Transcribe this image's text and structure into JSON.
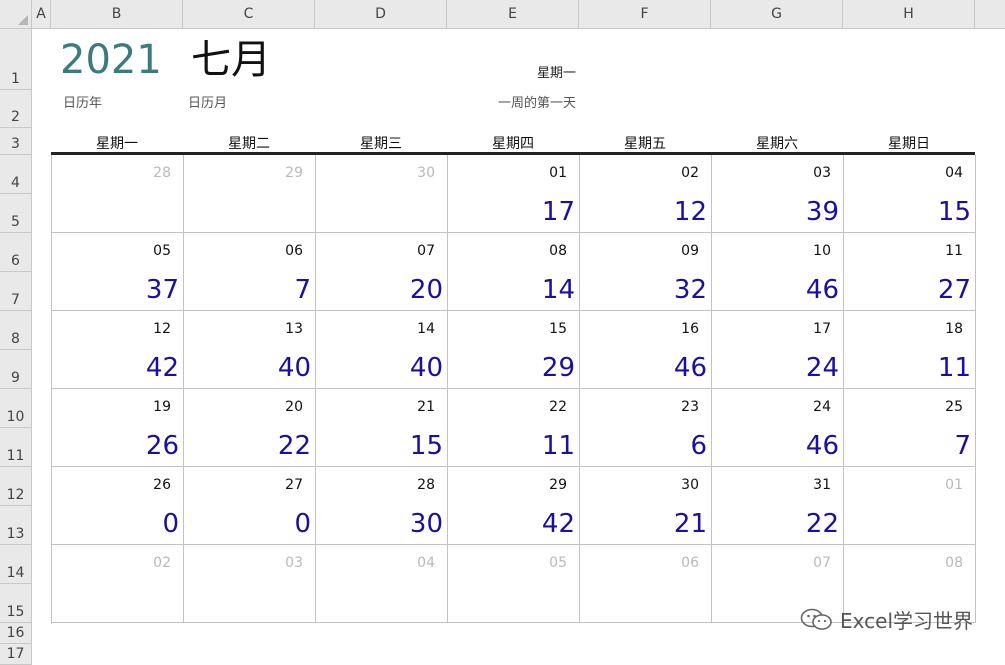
{
  "column_headers": [
    "A",
    "B",
    "C",
    "D",
    "E",
    "F",
    "G",
    "H"
  ],
  "row_headers": [
    "1",
    "2",
    "3",
    "4",
    "5",
    "6",
    "7",
    "8",
    "9",
    "10",
    "11",
    "12",
    "13",
    "14",
    "15",
    "16",
    "17"
  ],
  "title": {
    "year": "2021",
    "month": "七月",
    "year_label": "日历年",
    "month_label": "日历月",
    "week_start": "星期一",
    "week_start_label": "一周的第一天"
  },
  "weekdays": [
    "星期一",
    "星期二",
    "星期三",
    "星期四",
    "星期五",
    "星期六",
    "星期日"
  ],
  "weeks": [
    [
      {
        "day": "28",
        "value": "",
        "out": true
      },
      {
        "day": "29",
        "value": "",
        "out": true
      },
      {
        "day": "30",
        "value": "",
        "out": true
      },
      {
        "day": "01",
        "value": "17"
      },
      {
        "day": "02",
        "value": "12"
      },
      {
        "day": "03",
        "value": "39"
      },
      {
        "day": "04",
        "value": "15"
      }
    ],
    [
      {
        "day": "05",
        "value": "37"
      },
      {
        "day": "06",
        "value": "7"
      },
      {
        "day": "07",
        "value": "20"
      },
      {
        "day": "08",
        "value": "14"
      },
      {
        "day": "09",
        "value": "32"
      },
      {
        "day": "10",
        "value": "46"
      },
      {
        "day": "11",
        "value": "27"
      }
    ],
    [
      {
        "day": "12",
        "value": "42"
      },
      {
        "day": "13",
        "value": "40"
      },
      {
        "day": "14",
        "value": "40"
      },
      {
        "day": "15",
        "value": "29"
      },
      {
        "day": "16",
        "value": "46"
      },
      {
        "day": "17",
        "value": "24"
      },
      {
        "day": "18",
        "value": "11"
      }
    ],
    [
      {
        "day": "19",
        "value": "26"
      },
      {
        "day": "20",
        "value": "22"
      },
      {
        "day": "21",
        "value": "15"
      },
      {
        "day": "22",
        "value": "11"
      },
      {
        "day": "23",
        "value": "6"
      },
      {
        "day": "24",
        "value": "46"
      },
      {
        "day": "25",
        "value": "7"
      }
    ],
    [
      {
        "day": "26",
        "value": "0"
      },
      {
        "day": "27",
        "value": "0"
      },
      {
        "day": "28",
        "value": "30"
      },
      {
        "day": "29",
        "value": "42"
      },
      {
        "day": "30",
        "value": "21"
      },
      {
        "day": "31",
        "value": "22"
      },
      {
        "day": "01",
        "value": "",
        "out": true
      }
    ],
    [
      {
        "day": "02",
        "value": "",
        "out": true
      },
      {
        "day": "03",
        "value": "",
        "out": true
      },
      {
        "day": "04",
        "value": "",
        "out": true
      },
      {
        "day": "05",
        "value": "",
        "out": true
      },
      {
        "day": "06",
        "value": "",
        "out": true
      },
      {
        "day": "07",
        "value": "",
        "out": true
      },
      {
        "day": "08",
        "value": "",
        "out": true
      }
    ]
  ],
  "watermark": {
    "text": "Excel学习世界",
    "icon": "wechat-icon"
  },
  "colors": {
    "year": "#3a7a80",
    "value": "#1a0fa0",
    "out_of_month": "#b9b9b9"
  }
}
